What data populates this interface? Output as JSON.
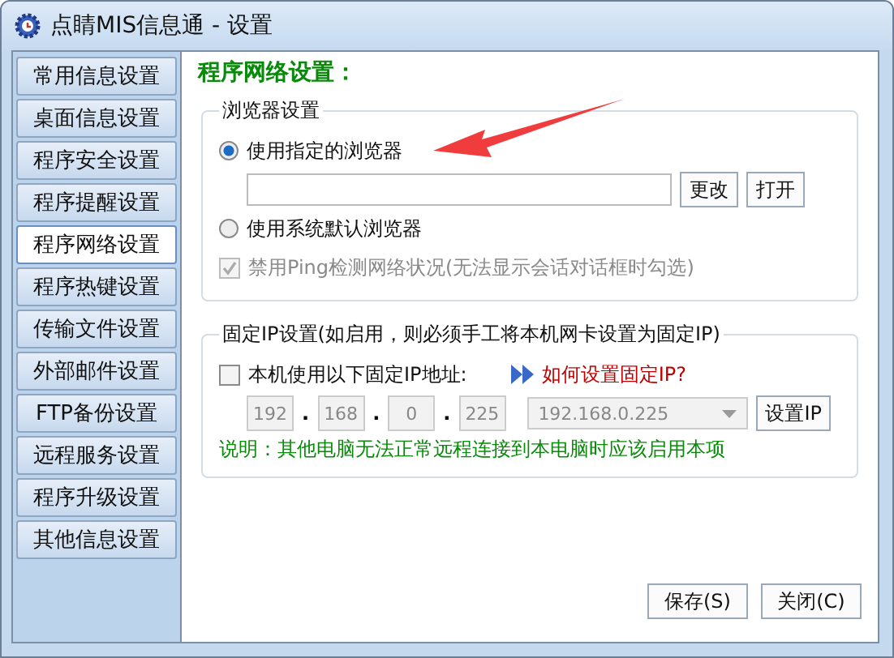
{
  "window": {
    "title": "点睛MIS信息通 - 设置"
  },
  "sidebar": {
    "items": [
      {
        "label": "常用信息设置",
        "selected": false
      },
      {
        "label": "桌面信息设置",
        "selected": false
      },
      {
        "label": "程序安全设置",
        "selected": false
      },
      {
        "label": "程序提醒设置",
        "selected": false
      },
      {
        "label": "程序网络设置",
        "selected": true
      },
      {
        "label": "程序热键设置",
        "selected": false
      },
      {
        "label": "传输文件设置",
        "selected": false
      },
      {
        "label": "外部邮件设置",
        "selected": false
      },
      {
        "label": "FTP备份设置",
        "selected": false
      },
      {
        "label": "远程服务设置",
        "selected": false
      },
      {
        "label": "程序升级设置",
        "selected": false
      },
      {
        "label": "其他信息设置",
        "selected": false
      }
    ]
  },
  "heading": "程序网络设置：",
  "browser_group": {
    "title": "浏览器设置",
    "radios": [
      {
        "label": "使用指定的浏览器",
        "selected": true
      },
      {
        "label": "使用系统默认浏览器",
        "selected": false
      }
    ],
    "buttons": [
      "更改",
      "打开"
    ],
    "ping_checkbox": {
      "label": "禁用Ping检测网络状况(无法显示会话对话框时勾选)",
      "checked": true,
      "disabled": true
    }
  },
  "ip_group": {
    "title": "固定IP设置(如启用，则必须手工将本机网卡设置为固定IP)",
    "checkbox": {
      "label": "本机使用以下固定IP地址:",
      "checked": false
    },
    "help_link": "如何设置固定IP?",
    "octets": [
      "192",
      "168",
      "0",
      "225"
    ],
    "separator": ".",
    "dropdown": {
      "value": "192.168.0.225"
    },
    "button": "设置IP",
    "note": "说明：其他电脑无法正常远程连接到本电脑时应该启用本项"
  },
  "footer_buttons": [
    "保存(S)",
    "关闭(C)"
  ]
}
